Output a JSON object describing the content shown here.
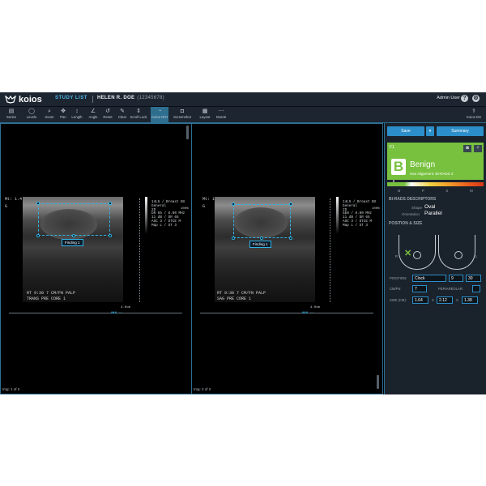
{
  "app": {
    "name": "koios",
    "study_list": "STUDY LIST",
    "patient_name": "HELEN R. DOE",
    "patient_id": "(12345678)",
    "user": "Admin User",
    "help_icon": "?",
    "gear_icon": "⚙"
  },
  "toolbar": [
    {
      "icon": "▤",
      "label": "Series"
    },
    {
      "icon": "◯",
      "label": "Levels"
    },
    {
      "icon": "⌕",
      "label": "Zoom"
    },
    {
      "icon": "✥",
      "label": "Pan"
    },
    {
      "icon": "↕",
      "label": "Length"
    },
    {
      "icon": "∠",
      "label": "Angle"
    },
    {
      "icon": "↺",
      "label": "Reset"
    },
    {
      "icon": "✎",
      "label": "Clear"
    },
    {
      "icon": "⇕",
      "label": "Scroll Lock"
    },
    {
      "icon": "◔",
      "label": "Koios ROI"
    },
    {
      "icon": "◘",
      "label": "Screenshot"
    },
    {
      "icon": "▦",
      "label": "Layout"
    },
    {
      "icon": "⋯",
      "label": "More▾"
    }
  ],
  "koios_ds": {
    "icon": "⚕",
    "label": "Koios DS"
  },
  "viewports": [
    {
      "label": "Img: 1 of 2",
      "finding": "Finding 1",
      "annotation_line1": "RT 9:30 7 CM/FN PALP",
      "annotation_line2": "TRANS PRE CORE 1",
      "info": [
        "14L5 / Breast BX",
        "General",
        "2D",
        "DR 65 / 8.00 MHz",
        "11 dB / DR 65",
        "ASC 3 / DTCE M",
        "Map L / ST 3"
      ],
      "side_marker": "Mt: 1.4",
      "side_marker2": "G",
      "percent": "100%",
      "scale_label": "4.0cm"
    },
    {
      "label": "Img: 2 of 2",
      "finding": "Finding 1",
      "annotation_line1": "RT 9:30 7 CM/FN PALP",
      "annotation_line2": "SAG PRE CORE 1",
      "info": [
        "14L5 / Breast BX",
        "General",
        "2D",
        "GEN / 8.00 MHz",
        "11 dB / DR 65",
        "ASC 3 / DTCE M",
        "Map L / ST 3"
      ],
      "side_marker": "Mt: 1.0",
      "side_marker2": "G",
      "percent": "100%",
      "scale_label": "4.0cm"
    }
  ],
  "sidebar": {
    "save_label": "Save",
    "dropdown_icon": "▾",
    "summary_label": "Summary",
    "finding_tab": "F1",
    "card_icon1": "◙",
    "card_icon2": "+",
    "grade_letter": "B",
    "result": "Benign",
    "alignment": "Has Alignment: BI-RADS 2",
    "scale_letters": [
      "B",
      "P",
      "S",
      "M"
    ],
    "descriptors_title": "BI-RADS DESCRIPTORS",
    "shape_label": "Shape",
    "shape_value": "Oval",
    "orientation_label": "Orientation",
    "orientation_value": "Parallel",
    "position_title": "POSITION & SIZE",
    "right_label": "R",
    "left_label": "L",
    "position_label": "POSITION:",
    "position_value": "Clock",
    "clock_value": "9",
    "minute_value": "30",
    "cmfn_label": "CM/FN:",
    "cmfn_value": "7",
    "periareolar_label": "PERIAREOLAR:",
    "size_label": "SIZE (CM):",
    "size_values": [
      "1.64",
      "2.12",
      "1.38"
    ],
    "size_sep": "X"
  }
}
